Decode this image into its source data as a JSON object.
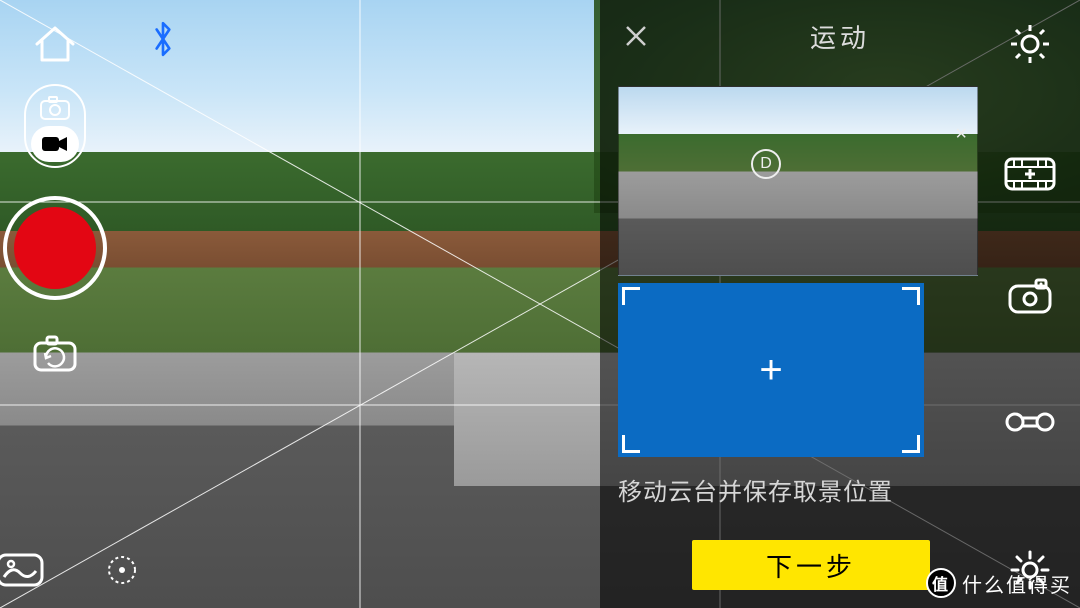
{
  "panel": {
    "title": "运动",
    "preset_badge": "D",
    "hint": "移动云台并保存取景位置",
    "next_label": "下一步",
    "add_symbol": "+",
    "close_symbol": "×"
  },
  "left_icons": {
    "home": "home-icon",
    "bluetooth": "bluetooth-icon",
    "mode_photo": "photo-mode-icon",
    "mode_video": "video-mode-icon",
    "record": "record-button",
    "switch_cam": "switch-camera-icon",
    "gallery": "gallery-icon",
    "focus": "focus-target-icon"
  },
  "right_icons": {
    "settings": "settings-gear-icon",
    "film_add": "film-add-icon",
    "gimbal": "gimbal-icon",
    "panorama": "panorama-icon",
    "brightness": "brightness-icon"
  },
  "colors": {
    "record_red": "#e30613",
    "primary_blue": "#0b6bc3",
    "next_yellow": "#ffe600",
    "bt_blue": "#1a6dff"
  },
  "watermark": {
    "badge": "值",
    "text": "什么值得买"
  }
}
